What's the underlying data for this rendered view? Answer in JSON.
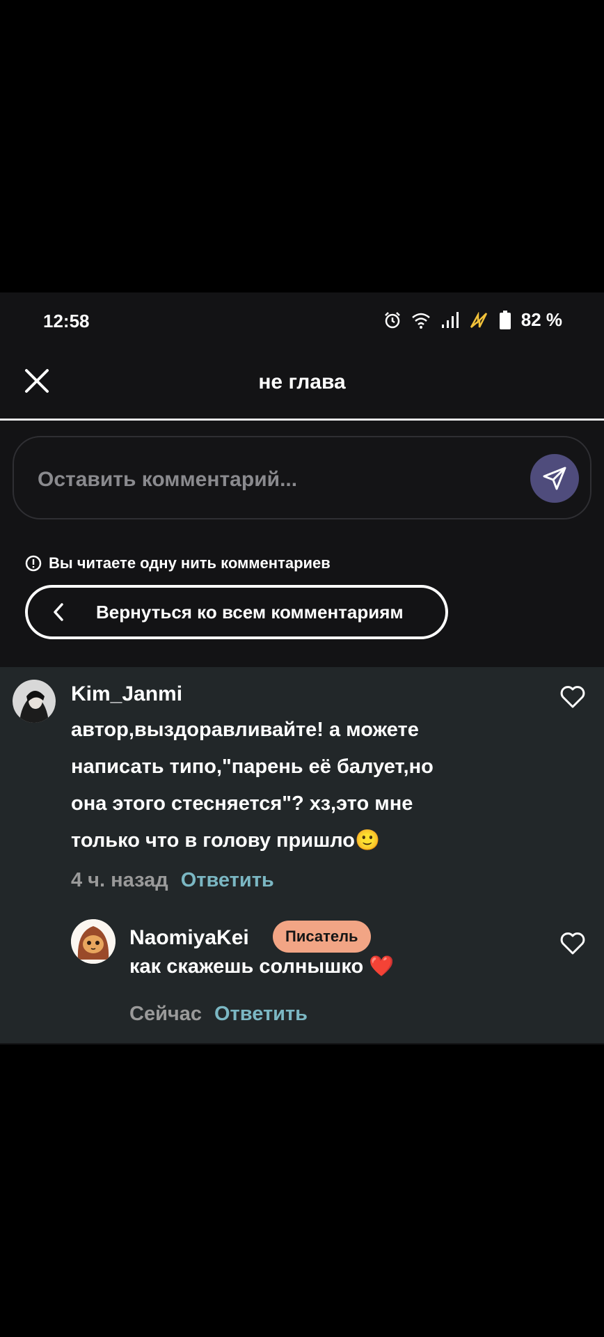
{
  "status_bar": {
    "time": "12:58",
    "battery": "82 %"
  },
  "header": {
    "title": "не глава"
  },
  "comment_input": {
    "placeholder": "Оставить комментарий..."
  },
  "thread_notice": {
    "text": "Вы читаете одну нить комментариев"
  },
  "back_button": {
    "label": "Вернуться ко всем комментариям"
  },
  "comments": [
    {
      "username": "Kim_Janmi",
      "lines": [
        "автор,выздоравливайте! а можете",
        "написать типо,\"парень её балует,но",
        "она этого стесняется\"? хз,это мне",
        "только что в голову пришло🙂"
      ],
      "time": "4 ч. назад",
      "reply_label": "Ответить"
    },
    {
      "username": "NaomiyaKei",
      "badge": "Писатель",
      "text": "как скажешь солнышко ❤️",
      "time": "Сейчас",
      "reply_label": "Ответить"
    }
  ],
  "colors": {
    "accent_reply": "#7bb7c3",
    "badge_bg": "#f2a585",
    "send_button": "#4f4c7c",
    "comments_bg": "#222729"
  }
}
